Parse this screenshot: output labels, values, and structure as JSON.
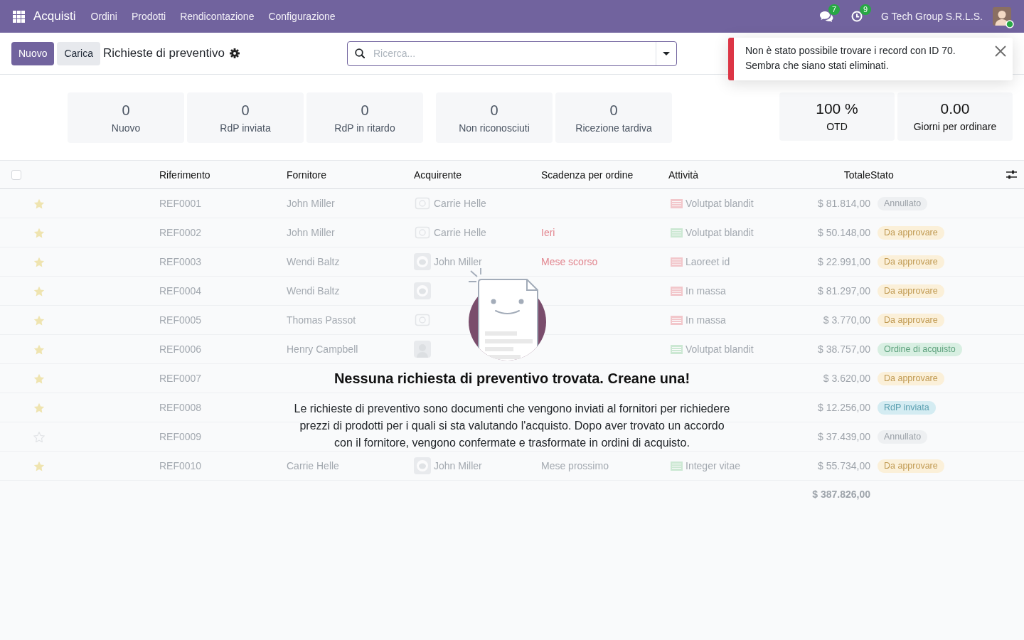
{
  "navbar": {
    "app_name": "Acquisti",
    "menus": [
      "Ordini",
      "Prodotti",
      "Rendicontazione",
      "Configurazione"
    ],
    "messages_count": "7",
    "activities_count": "9",
    "company": "G Tech Group S.R.L.S.",
    "user_online": true
  },
  "control_panel": {
    "buttons": [
      {
        "label": "Nuovo",
        "kind": "primary"
      },
      {
        "label": "Carica",
        "kind": "secondary"
      }
    ],
    "title": "Richieste di preventivo",
    "search": {
      "placeholder": "Ricerca..."
    }
  },
  "notification": {
    "kind": "danger",
    "message_lines": [
      "Non è stato possibile trovare i record con ID 70.",
      "Sembra che siano stati eliminati."
    ]
  },
  "dashboard": {
    "groups": [
      {
        "kind": "filter",
        "cards": [
          {
            "value": "0",
            "label": "Nuovo"
          },
          {
            "value": "0",
            "label": "RdP inviata"
          },
          {
            "value": "0",
            "label": "RdP in ritardo"
          }
        ]
      },
      {
        "kind": "filter",
        "cards": [
          {
            "value": "0",
            "label": "Non riconosciuti"
          },
          {
            "value": "0",
            "label": "Ricezione tardiva"
          }
        ]
      },
      {
        "kind": "kpi",
        "cards": [
          {
            "value": "100 %",
            "label": "OTD"
          },
          {
            "value": "0.00",
            "label": "Giorni per ordinare"
          }
        ]
      }
    ]
  },
  "table": {
    "select_all_checked": false,
    "columns": [
      {
        "label": "Riferimento",
        "kind": "text"
      },
      {
        "label": "Fornitore",
        "kind": "text"
      },
      {
        "label": "Acquirente",
        "kind": "text"
      },
      {
        "label": "Scadenza per ordine",
        "kind": "text"
      },
      {
        "label": "Attività",
        "kind": "text"
      },
      {
        "label": "Totale",
        "kind": "monetary"
      },
      {
        "label": "Stato",
        "kind": "text"
      }
    ],
    "rows": [
      {
        "favorite": true,
        "reference": "REF0001",
        "vendor": "John Miller",
        "buyer": {
          "kind": "placeholder",
          "name": "Carrie Helle"
        },
        "activity": {
          "overdue": true,
          "summary": "Volutpat blandit"
        },
        "total": "$ 81.814,00",
        "status": {
          "kind": "cancel",
          "label": "Annullato"
        }
      },
      {
        "favorite": true,
        "reference": "REF0002",
        "vendor": "John Miller",
        "buyer": {
          "kind": "placeholder",
          "name": "Carrie Helle"
        },
        "deadline": {
          "text": "Ieri",
          "overdue": true
        },
        "activity": {
          "overdue": false,
          "summary": "Volutpat blandit"
        },
        "total": "$ 50.148,00",
        "status": {
          "kind": "to_approve",
          "label": "Da approvare"
        }
      },
      {
        "favorite": true,
        "reference": "REF0003",
        "vendor": "Wendi Baltz",
        "buyer": {
          "kind": "ring",
          "name": "John Miller"
        },
        "deadline": {
          "text": "Mese scorso",
          "overdue": true
        },
        "activity": {
          "overdue": true,
          "summary": "Laoreet id"
        },
        "total": "$ 22.991,00",
        "status": {
          "kind": "to_approve",
          "label": "Da approvare"
        }
      },
      {
        "favorite": true,
        "reference": "REF0004",
        "vendor": "Wendi Baltz",
        "buyer": {
          "kind": "ring"
        },
        "activity": {
          "overdue": true,
          "summary": "In massa"
        },
        "total": "$ 81.297,00",
        "status": {
          "kind": "to_approve",
          "label": "Da approvare"
        }
      },
      {
        "favorite": true,
        "reference": "REF0005",
        "vendor": "Thomas Passot",
        "buyer": {
          "kind": "placeholder"
        },
        "activity": {
          "overdue": true,
          "summary": "In massa"
        },
        "total": "$ 3.770,00",
        "status": {
          "kind": "to_approve",
          "label": "Da approvare"
        }
      },
      {
        "favorite": true,
        "reference": "REF0006",
        "vendor": "Henry Campbell",
        "buyer": {
          "kind": "face"
        },
        "activity": {
          "overdue": false,
          "summary": "Volutpat blandit"
        },
        "total": "$ 38.757,00",
        "status": {
          "kind": "purchase",
          "label": "Ordine di acquisto"
        }
      },
      {
        "favorite": true,
        "reference": "REF0007",
        "total": "$ 3.620,00",
        "status": {
          "kind": "to_approve",
          "label": "Da approvare"
        }
      },
      {
        "favorite": true,
        "reference": "REF0008",
        "total": "$ 12.256,00",
        "status": {
          "kind": "sent",
          "label": "RdP inviata"
        }
      },
      {
        "favorite": false,
        "reference": "REF0009",
        "total": "$ 37.439,00",
        "status": {
          "kind": "cancel",
          "label": "Annullato"
        }
      },
      {
        "favorite": true,
        "reference": "REF0010",
        "vendor": "Carrie Helle",
        "buyer": {
          "kind": "ring",
          "name": "John Miller"
        },
        "deadline": {
          "text": "Mese prossimo",
          "overdue": false
        },
        "activity": {
          "overdue": false,
          "summary": "Integer vitae"
        },
        "total": "$ 55.734,00",
        "status": {
          "kind": "to_approve",
          "label": "Da approvare"
        }
      }
    ],
    "sum_total": "$ 387.826,00"
  },
  "empty_state": {
    "title": "Nessuna richiesta di preventivo trovata. Creane una!",
    "description": "Le richieste di preventivo sono documenti che vengono inviati al fornitori per richiedere prezzi di prodotti per i quali si sta valutando l'acquisto. Dopo aver trovato un accordo con il fornitore, vengono confermate e trasformate in ordini di acquisto."
  }
}
